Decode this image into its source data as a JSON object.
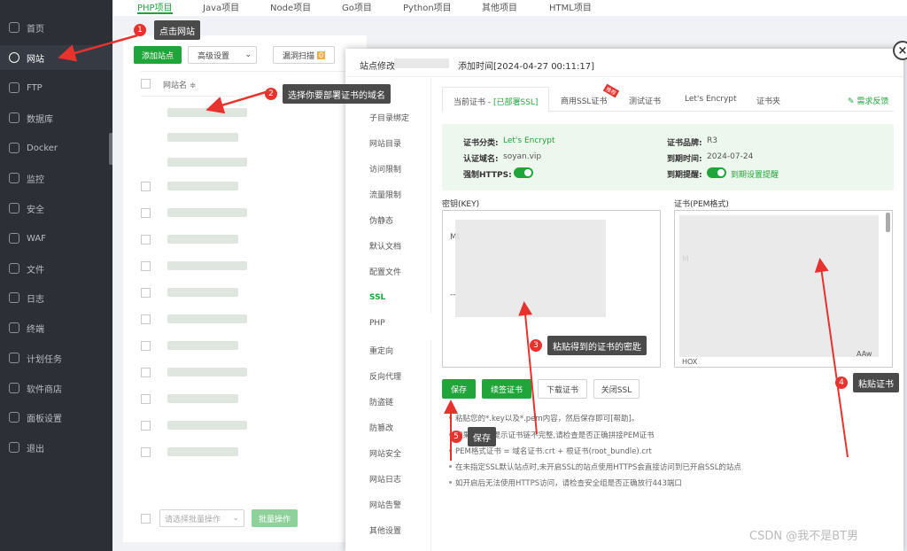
{
  "sidebar": {
    "items": [
      {
        "label": "首页",
        "icon": "home-icon"
      },
      {
        "label": "网站",
        "icon": "globe-icon",
        "active": true
      },
      {
        "label": "FTP",
        "icon": "ftp-icon"
      },
      {
        "label": "数据库",
        "icon": "database-icon"
      },
      {
        "label": "Docker",
        "icon": "docker-icon"
      },
      {
        "label": "监控",
        "icon": "monitor-icon"
      },
      {
        "label": "安全",
        "icon": "shield-icon"
      },
      {
        "label": "WAF",
        "icon": "waf-icon"
      },
      {
        "label": "文件",
        "icon": "folder-icon"
      },
      {
        "label": "日志",
        "icon": "log-icon"
      },
      {
        "label": "终端",
        "icon": "terminal-icon"
      },
      {
        "label": "计划任务",
        "icon": "clock-icon"
      },
      {
        "label": "软件商店",
        "icon": "store-icon"
      },
      {
        "label": "面板设置",
        "icon": "gear-icon"
      },
      {
        "label": "退出",
        "icon": "logout-icon"
      }
    ]
  },
  "project_tabs": [
    "PHP项目",
    "Java项目",
    "Node项目",
    "Go项目",
    "Python项目",
    "其他项目",
    "HTML项目"
  ],
  "toolbar": {
    "add_site": "添加站点",
    "advanced": "高级设置",
    "scan": "漏洞扫描",
    "scan_badge": "0"
  },
  "table": {
    "col_site": "网站名 ≑"
  },
  "footer": {
    "batch_select": "请选择批量操作",
    "batch_btn": "批量操作"
  },
  "modal": {
    "title_prefix": "站点修改",
    "added_time": "添加时间[2024-04-27 00:11:17]",
    "nav": [
      "子目录绑定",
      "网站目录",
      "访问限制",
      "流量限制",
      "伪静态",
      "默认文档",
      "配置文件",
      "SSL",
      "PHP",
      "重定向",
      "反向代理",
      "防盗链",
      "防篡改",
      "网站安全",
      "网站日志",
      "网站告警",
      "其他设置"
    ],
    "ssl_tabs": {
      "current": "当前证书 - ",
      "current_status": "[已部署SSL]",
      "commercial": "商用SSL证书",
      "commercial_badge": "推荐",
      "test": "测试证书",
      "letsencrypt": "Let's Encrypt",
      "folder": "证书夹",
      "feedback": "需求反馈"
    },
    "info": {
      "type_label": "证书分类:",
      "type_value": "Let's Encrypt",
      "domain_label": "认证域名:",
      "domain_value": "soyan.vip",
      "https_label": "强制HTTPS:",
      "brand_label": "证书品牌:",
      "brand_value": "R3",
      "expire_label": "到期时间:",
      "expire_value": "2024-07-24",
      "remind_label": "到期提醒:",
      "remind_link": "到期设置提醒"
    },
    "key_label": "密钥(KEY)",
    "cert_label": "证书(PEM格式)",
    "key_fragment_1": "MI",
    "key_fragment_2": "--",
    "cert_fragment_1": "M",
    "cert_fragment_2": "AAw",
    "cert_fragment_3": "HOX",
    "buttons": {
      "save": "保存",
      "renew": "续签证书",
      "download": "下载证书",
      "close_ssl": "关闭SSL"
    },
    "tips": [
      "粘贴您的*.key以及*.pem内容，然后保存即可[帮助]。",
      "如果浏览器提示证书链不完整,请检查是否正确拼接PEM证书",
      "PEM格式证书 = 域名证书.crt + 根证书(root_bundle).crt",
      "在未指定SSL默认站点时,未开启SSL的站点使用HTTPS会直接访问到已开启SSL的站点",
      "如开启后无法使用HTTPS访问，请检查安全组是否正确放行443端口"
    ]
  },
  "annotations": [
    {
      "num": "1",
      "text": "点击网站"
    },
    {
      "num": "2",
      "text": "选择你要部署证书的域名"
    },
    {
      "num": "3",
      "text": "粘贴得到的证书的密匙"
    },
    {
      "num": "4",
      "text": "粘贴证书"
    },
    {
      "num": "5",
      "text": "保存"
    }
  ],
  "watermark": "CSDN @我不是BT男",
  "colors": {
    "accent": "#20a53a",
    "sidebar": "#2c2f36",
    "annotation_red": "#e8322d"
  }
}
